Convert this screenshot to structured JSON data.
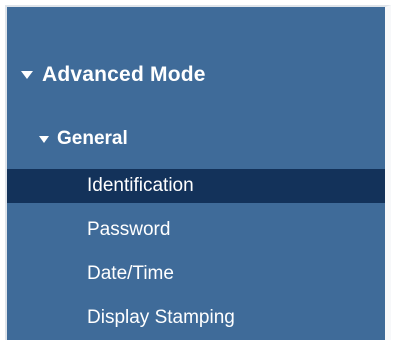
{
  "nav": {
    "section": {
      "label": "Advanced Mode",
      "icon": "triangle-down-icon"
    },
    "group": {
      "label": "General",
      "icon": "triangle-down-icon"
    },
    "items": [
      {
        "label": "Identification",
        "selected": true
      },
      {
        "label": "Password",
        "selected": false
      },
      {
        "label": "Date/Time",
        "selected": false
      },
      {
        "label": "Display Stamping",
        "selected": false
      }
    ]
  },
  "colors": {
    "panel_bg": "#3f6b99",
    "selected_bg": "#13325a",
    "text": "#ffffff"
  }
}
